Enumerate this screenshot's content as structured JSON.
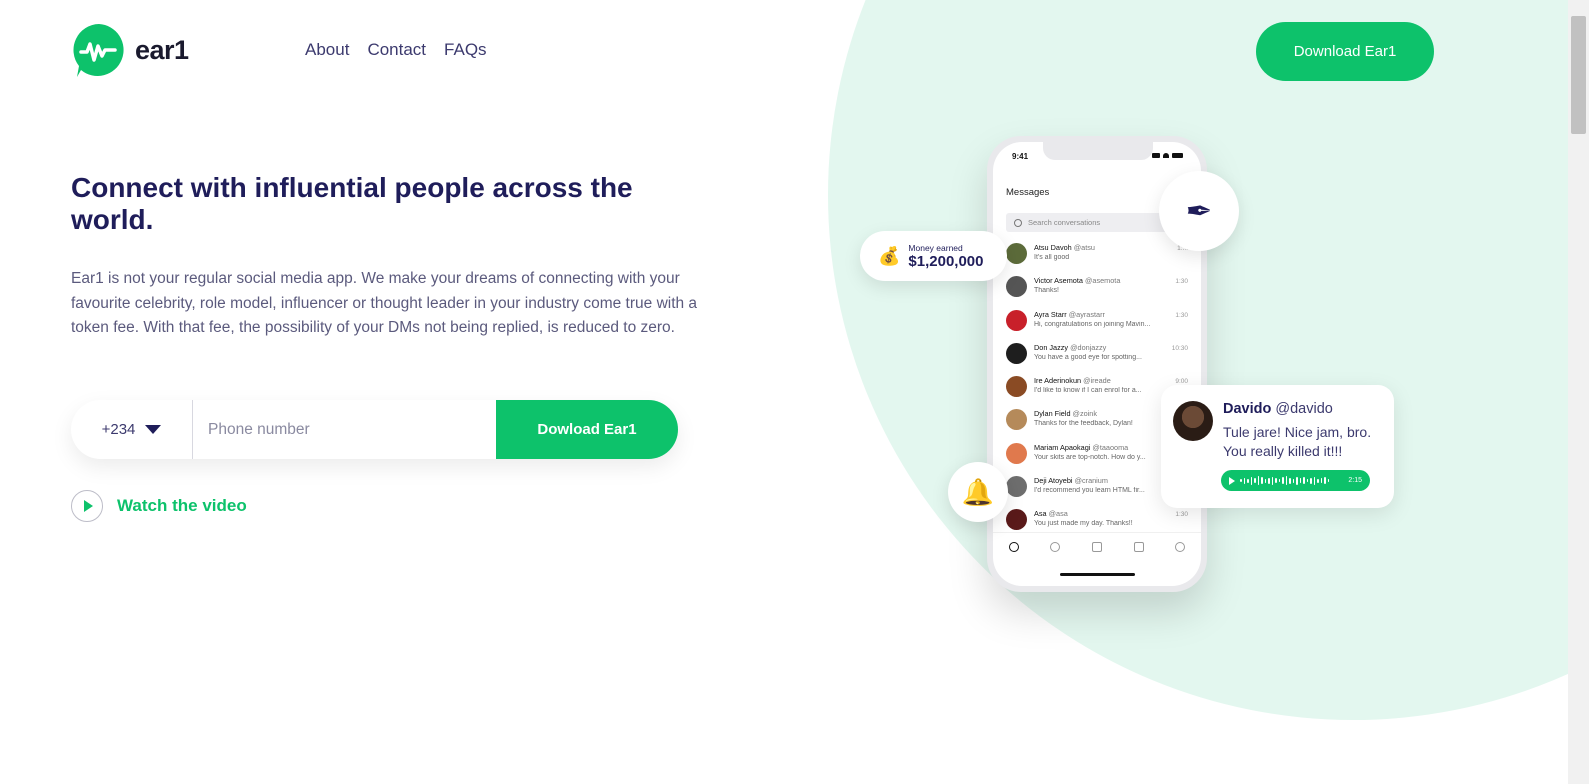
{
  "brand": {
    "name": "ear1",
    "accent": "#0dc26b",
    "navy": "#1f1d5a"
  },
  "nav": {
    "items": [
      {
        "label": "About"
      },
      {
        "label": "Contact"
      },
      {
        "label": "FAQs"
      }
    ]
  },
  "header": {
    "download_label": "Download Ear1"
  },
  "hero": {
    "title": "Connect with influential people across the world.",
    "text": "Ear1 is not your regular social media app. We make your dreams of connecting with your favourite celebrity, role model, influencer or thought leader in your industry come true with a token fee. With that fee, the possibility of your DMs not being replied, is reduced to zero."
  },
  "form": {
    "country_code": "+234",
    "phone_placeholder": "Phone number",
    "phone_value": "",
    "button_label": "Dowload Ear1"
  },
  "watch": {
    "label": "Watch the video"
  },
  "phone": {
    "time": "9:41",
    "title": "Messages",
    "search_placeholder": "Search conversations",
    "conversations": [
      {
        "name": "Atsu Davoh",
        "handle": "@atsu",
        "preview": "It's all good",
        "time": "1:..."
      },
      {
        "name": "Victor Asemota",
        "handle": "@asemota",
        "preview": "Thanks!",
        "time": "1:30"
      },
      {
        "name": "Ayra Starr",
        "handle": "@ayrastarr",
        "preview": "Hi, congratulations on joining Mavin...",
        "time": "1:30"
      },
      {
        "name": "Don Jazzy",
        "handle": "@donjazzy",
        "preview": "You have a good eye for spotting...",
        "time": "10:30"
      },
      {
        "name": "Ire Aderinokun",
        "handle": "@ireade",
        "preview": "I'd like to know if I can enrol for a...",
        "time": "9:00"
      },
      {
        "name": "Dylan Field",
        "handle": "@zoink",
        "preview": "Thanks for the feedback, Dylan!",
        "time": ""
      },
      {
        "name": "Mariam Apaokagi",
        "handle": "@taaooma",
        "preview": "Your skits are top-notch. How do y...",
        "time": ""
      },
      {
        "name": "Deji Atoyebi",
        "handle": "@cranium",
        "preview": "I'd recommend you learn HTML fir...",
        "time": ""
      },
      {
        "name": "Asa",
        "handle": "@asa",
        "preview": "You just made my day. Thanks!!",
        "time": "1:30"
      }
    ]
  },
  "money": {
    "label": "Money earned",
    "value": "$1,200,000",
    "icon": "money-bag-icon"
  },
  "card": {
    "name": "Davido",
    "handle": "@davido",
    "message": "Tule jare! Nice jam, bro. You really killed it!!!",
    "voice_duration": "2:15"
  }
}
